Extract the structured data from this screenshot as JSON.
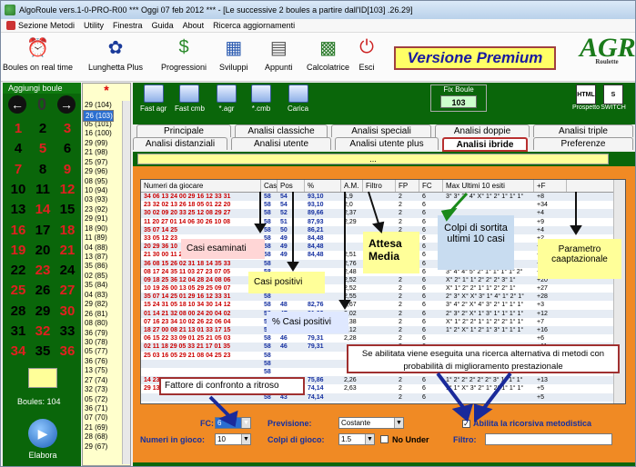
{
  "window": {
    "title": "AlgoRoule vers.1-0-PRO-R00   ***  Oggi 07 feb 2012  ***  - [Le successive 2 boules a partire dall'ID[103] .26.29]"
  },
  "menu": [
    "Sezione Metodi",
    "Utility",
    "Finestra",
    "Guida",
    "About",
    "Ricerca aggiornamenti"
  ],
  "toolbar": [
    {
      "label": "Boules on real time",
      "icon": "clock-icon"
    },
    {
      "label": "Lunghetta Plus",
      "icon": "lottery-logo-icon"
    },
    {
      "label": "Progressioni",
      "icon": "dollar-icon"
    },
    {
      "label": "Sviluppi",
      "icon": "calendar-icon"
    },
    {
      "label": "Appunti",
      "icon": "clipboard-icon"
    },
    {
      "label": "Calcolatrice",
      "icon": "calculator-icon"
    },
    {
      "label": "Esci",
      "icon": "exit-icon"
    }
  ],
  "premium_label": "Versione Premium",
  "logo": {
    "text": "AGR",
    "sub": "Roulette"
  },
  "left_panel": {
    "header": "Aggiungi boule",
    "zero": "0",
    "numbers": [
      "1",
      "2",
      "3",
      "4",
      "5",
      "6",
      "7",
      "8",
      "9",
      "10",
      "11",
      "12",
      "13",
      "14",
      "15",
      "16",
      "17",
      "18",
      "19",
      "20",
      "21",
      "22",
      "23",
      "24",
      "25",
      "26",
      "27",
      "28",
      "29",
      "30",
      "31",
      "32",
      "33",
      "34",
      "35",
      "36"
    ],
    "red": [
      1,
      3,
      5,
      7,
      9,
      12,
      14,
      16,
      18,
      19,
      21,
      23,
      25,
      27,
      30,
      32,
      34,
      36
    ],
    "boules_label": "Boules: 104",
    "elabora_label": "Elabora"
  },
  "history": {
    "star": "*",
    "items": [
      "29 (104)",
      "26 (103)",
      "35 (102)",
      "05 (101)",
      "16 (100)",
      "29 (99)",
      "21 (98)",
      "25 (97)",
      "29 (96)",
      "08 (95)",
      "10 (94)",
      "03 (93)",
      "23 (92)",
      "29 (91)",
      "18 (90)",
      "11 (89)",
      "04 (88)",
      "13 (87)",
      "35 (86)",
      "02 (85)",
      "35 (84)",
      "04 (83)",
      "29 (82)",
      "26 (81)",
      "08 (80)",
      "36 (79)",
      "30 (78)",
      "05 (77)",
      "36 (76)",
      "13 (75)",
      "27 (74)",
      "32 (73)",
      "05 (72)",
      "36 (71)",
      "07 (70)",
      "21 (69)",
      "28 (68)",
      "29 (67)"
    ],
    "selected": 1
  },
  "green_toolbar": [
    {
      "label": "Fast agr"
    },
    {
      "label": "Fast cmb"
    },
    {
      "label": "*.agr"
    },
    {
      "label": "*.cmb"
    },
    {
      "label": "Carica"
    }
  ],
  "fix_boule": {
    "label": "Fix Boule",
    "value": "103"
  },
  "right_buttons": [
    {
      "label": "Prospetto",
      "icon": "HTML"
    },
    {
      "label": "SWITCH",
      "icon": "S"
    }
  ],
  "tabs_row1": [
    "Principale",
    "Analisi classiche",
    "Analisi speciali",
    "Analisi doppie",
    "Analisi triple"
  ],
  "tabs_row2": [
    "Analisi distanziali",
    "Analisi utente",
    "Analisi utente plus",
    "Analisi ibride",
    "Preferenze"
  ],
  "strip_text": "...",
  "grid": {
    "headers": [
      "Numeri da giocare",
      "Casi",
      "Pos",
      "%",
      "A.M.",
      "Filtro",
      "FP",
      "FC",
      "Max Ultimi 10 esiti",
      "+F",
      ""
    ],
    "rows": [
      [
        "34 06 13 24 00 29 16 12 33 31",
        "58",
        "54",
        "93,10",
        "1,9",
        "",
        "2",
        "6",
        "3° 3° 3° 4° X° 1° 2° 1° 1° 1°",
        "+8"
      ],
      [
        "23 32 02 13 26 18 05 01 22 20",
        "58",
        "54",
        "93,10",
        "2,0",
        "",
        "2",
        "6",
        "",
        "+34"
      ],
      [
        "30 02 09 20 33 25 12 08 29 27",
        "58",
        "52",
        "89,66",
        "2,37",
        "",
        "2",
        "6",
        "",
        "+4"
      ],
      [
        "11 20 27 01 14 06 30 26 10 08",
        "58",
        "51",
        "87,93",
        "2,29",
        "",
        "2",
        "6",
        "",
        "+9"
      ],
      [
        "35 07 14 25",
        "58",
        "50",
        "86,21",
        "",
        "",
        "2",
        "6",
        "",
        "+4"
      ],
      [
        "33 05 12 23",
        "58",
        "49",
        "84,48",
        "",
        "",
        "2",
        "6",
        "",
        "+2"
      ],
      [
        "20 29 36 10",
        "58",
        "49",
        "84,48",
        "",
        "",
        "2",
        "6",
        "",
        "+6"
      ],
      [
        "21 30 00 11 24 16 03 14 09 20",
        "58",
        "49",
        "84,48",
        "2,51",
        "",
        "2",
        "6",
        "",
        "+8"
      ],
      [
        "36 08 15 26 02 31 18 14 35 33",
        "58",
        "",
        "",
        "2,76",
        "",
        "2",
        "6",
        "",
        "+2"
      ],
      [
        "08 17 24 35 11 03 27 23 07 05",
        "58",
        "",
        "",
        "2,48",
        "",
        "2",
        "6",
        "3° 4° 4° 5° 2° 1° 1° 1° 1° 2°",
        "+7"
      ],
      [
        "09 18 25 36 12 04 28 24 08 06",
        "58",
        "",
        "",
        "2,52",
        "",
        "2",
        "6",
        "X° 2° 1° 1° 2° 2° 2° 3° 1°",
        "+20"
      ],
      [
        "10 19 26 00 13 05 29 25 09 07",
        "58",
        "",
        "",
        "2,52",
        "",
        "2",
        "6",
        "X° 1° 2° 2° 1° 1° 2° 2° 1°",
        "+27"
      ],
      [
        "35 07 14 25 01 29 16 12 33 31",
        "58",
        "",
        "",
        "2,55",
        "",
        "2",
        "6",
        "2° 3° X° X° 3° 1° 4° 1° 2° 1°",
        "+28"
      ],
      [
        "15 24 31 05 18 10 34 30 14 12",
        "58",
        "48",
        "82,76",
        "2,67",
        "",
        "2",
        "6",
        "3° 4° 2° X° 4° 3° 2° 1° 1° 1°",
        "+3"
      ],
      [
        "01 14 21 32 08 00 24 20 04 02",
        "58",
        "47",
        "81,03",
        "2,02",
        "",
        "2",
        "6",
        "2° 3° 2° X° 1° 3° 1° 1° 1° 1°",
        "+12"
      ],
      [
        "07 16 23 34 10 02 26 22 06 04",
        "58",
        "47",
        "81,03",
        "2,38",
        "",
        "2",
        "6",
        "X° 1° 2° 2° 1° 1° 2° 2° 1° 1°",
        "+7"
      ],
      [
        "18 27 00 08 21 13 01 33 17 15",
        "58",
        "47",
        "81,03",
        "2,12",
        "",
        "2",
        "6",
        "1° 2° X° 1° 2° 1° 3° 1° 1° 1°",
        "+16"
      ],
      [
        "06 15 22 33 09 01 25 21 05 03",
        "58",
        "46",
        "79,31",
        "2,28",
        "",
        "2",
        "6",
        "",
        "+6"
      ],
      [
        "02 11 18 29 05 33 21 17 01 35",
        "58",
        "46",
        "79,31",
        "",
        "",
        "2",
        "6",
        "",
        "+11"
      ],
      [
        "25 03 16 05 29 21 08 04 25 23",
        "58",
        "",
        "",
        "",
        "",
        "2",
        "6",
        "",
        "+5"
      ],
      [
        "",
        "58",
        "",
        "",
        "",
        "",
        "2",
        "6",
        "",
        "+11"
      ],
      [
        "",
        "58",
        "",
        "",
        "",
        "",
        "2",
        "6",
        "",
        "+4"
      ],
      [
        "14 23 30 04 17 09 33 29 13 11",
        "58",
        "44",
        "75,86",
        "2,26",
        "",
        "2",
        "6",
        "1° 2° 2° 2° 2° 2° 3° 1° 1° 1°",
        "+13"
      ],
      [
        "29 13 23 33 07 10 36 32 16 14",
        "58",
        "43",
        "74,14",
        "2,63",
        "",
        "2",
        "6",
        "1° 1° X° 3° 2° 1° 2° 1° 1° 1°",
        "+5"
      ],
      [
        "",
        "58",
        "43",
        "74,14",
        "",
        "",
        "2",
        "6",
        "",
        "+5"
      ]
    ]
  },
  "annotations": {
    "casi_esaminati": "Casi esaminati",
    "casi_positivi": "Casi positivi",
    "perc_positivi": "% Casi positivi",
    "attesa_media": "Attesa Media",
    "colpi_sortita": "Colpi di sortita ultimi 10 casi",
    "parametro": "Parametro caaptazionale",
    "ricorsiva_note": "Se abilitata viene eseguita una ricerca alternativa di metodi con probabilità di miglioramento prestazionale",
    "fattore": "Fattore di confronto a ritroso"
  },
  "form": {
    "fc_label": "FC:",
    "fc_value": "6",
    "numeri_label": "Numeri in gioco:",
    "numeri_value": "10",
    "previsione_label": "Previsione:",
    "previsione_value": "Costante",
    "colpi_label": "Colpi di gioco:",
    "colpi_value": "1.5",
    "nounder_label": "No Under",
    "ricorsiva_label": "Abilita la ricorsiva metodistica",
    "filtro_label": "Filtro:"
  }
}
